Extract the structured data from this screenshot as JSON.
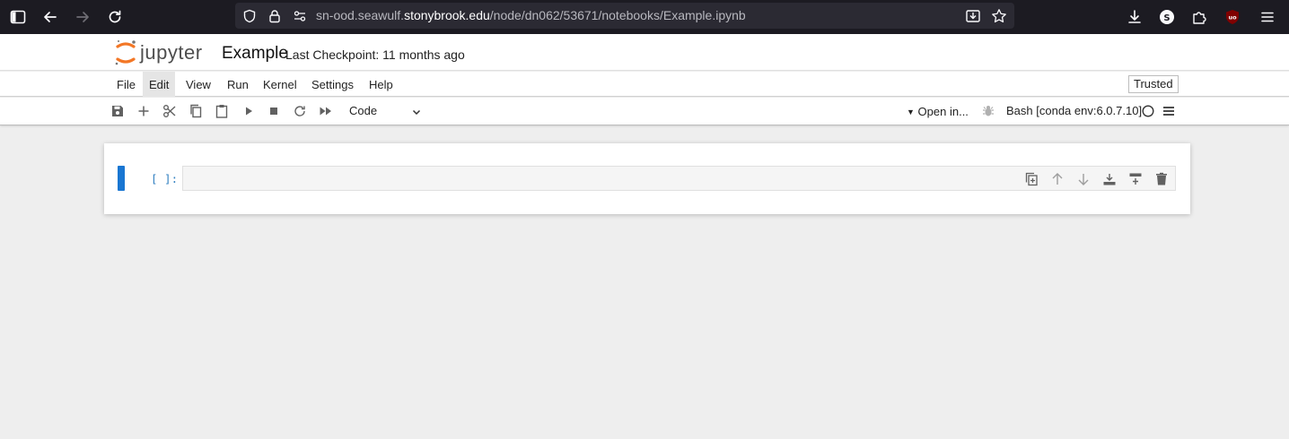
{
  "browser": {
    "url_prefix": "sn-ood.seawulf.",
    "url_host": "stonybrook.edu",
    "url_path": "/node/dn062/53671/notebooks/Example.ipynb",
    "profile_initial": "S",
    "extension_badge": "uo"
  },
  "notebook": {
    "logo_text": "jupyter",
    "title": "Example",
    "checkpoint": "Last Checkpoint: 11 months ago"
  },
  "menu": {
    "items": [
      "File",
      "Edit",
      "View",
      "Run",
      "Kernel",
      "Settings",
      "Help"
    ],
    "active": "Edit",
    "trusted_label": "Trusted"
  },
  "toolbar": {
    "cell_type": "Code",
    "open_in": "Open in...",
    "kernel": "Bash [conda env:6.0.7.10]"
  },
  "cell": {
    "prompt": "[ ]:",
    "source": ""
  },
  "colors": {
    "browser_bg": "#1c1b22",
    "urlbar_bg": "#2b2a33",
    "accent_blue": "#1976d2",
    "prompt_blue": "#307fc1",
    "jupyter_orange": "#f37726",
    "page_bg": "#eeeeee"
  }
}
